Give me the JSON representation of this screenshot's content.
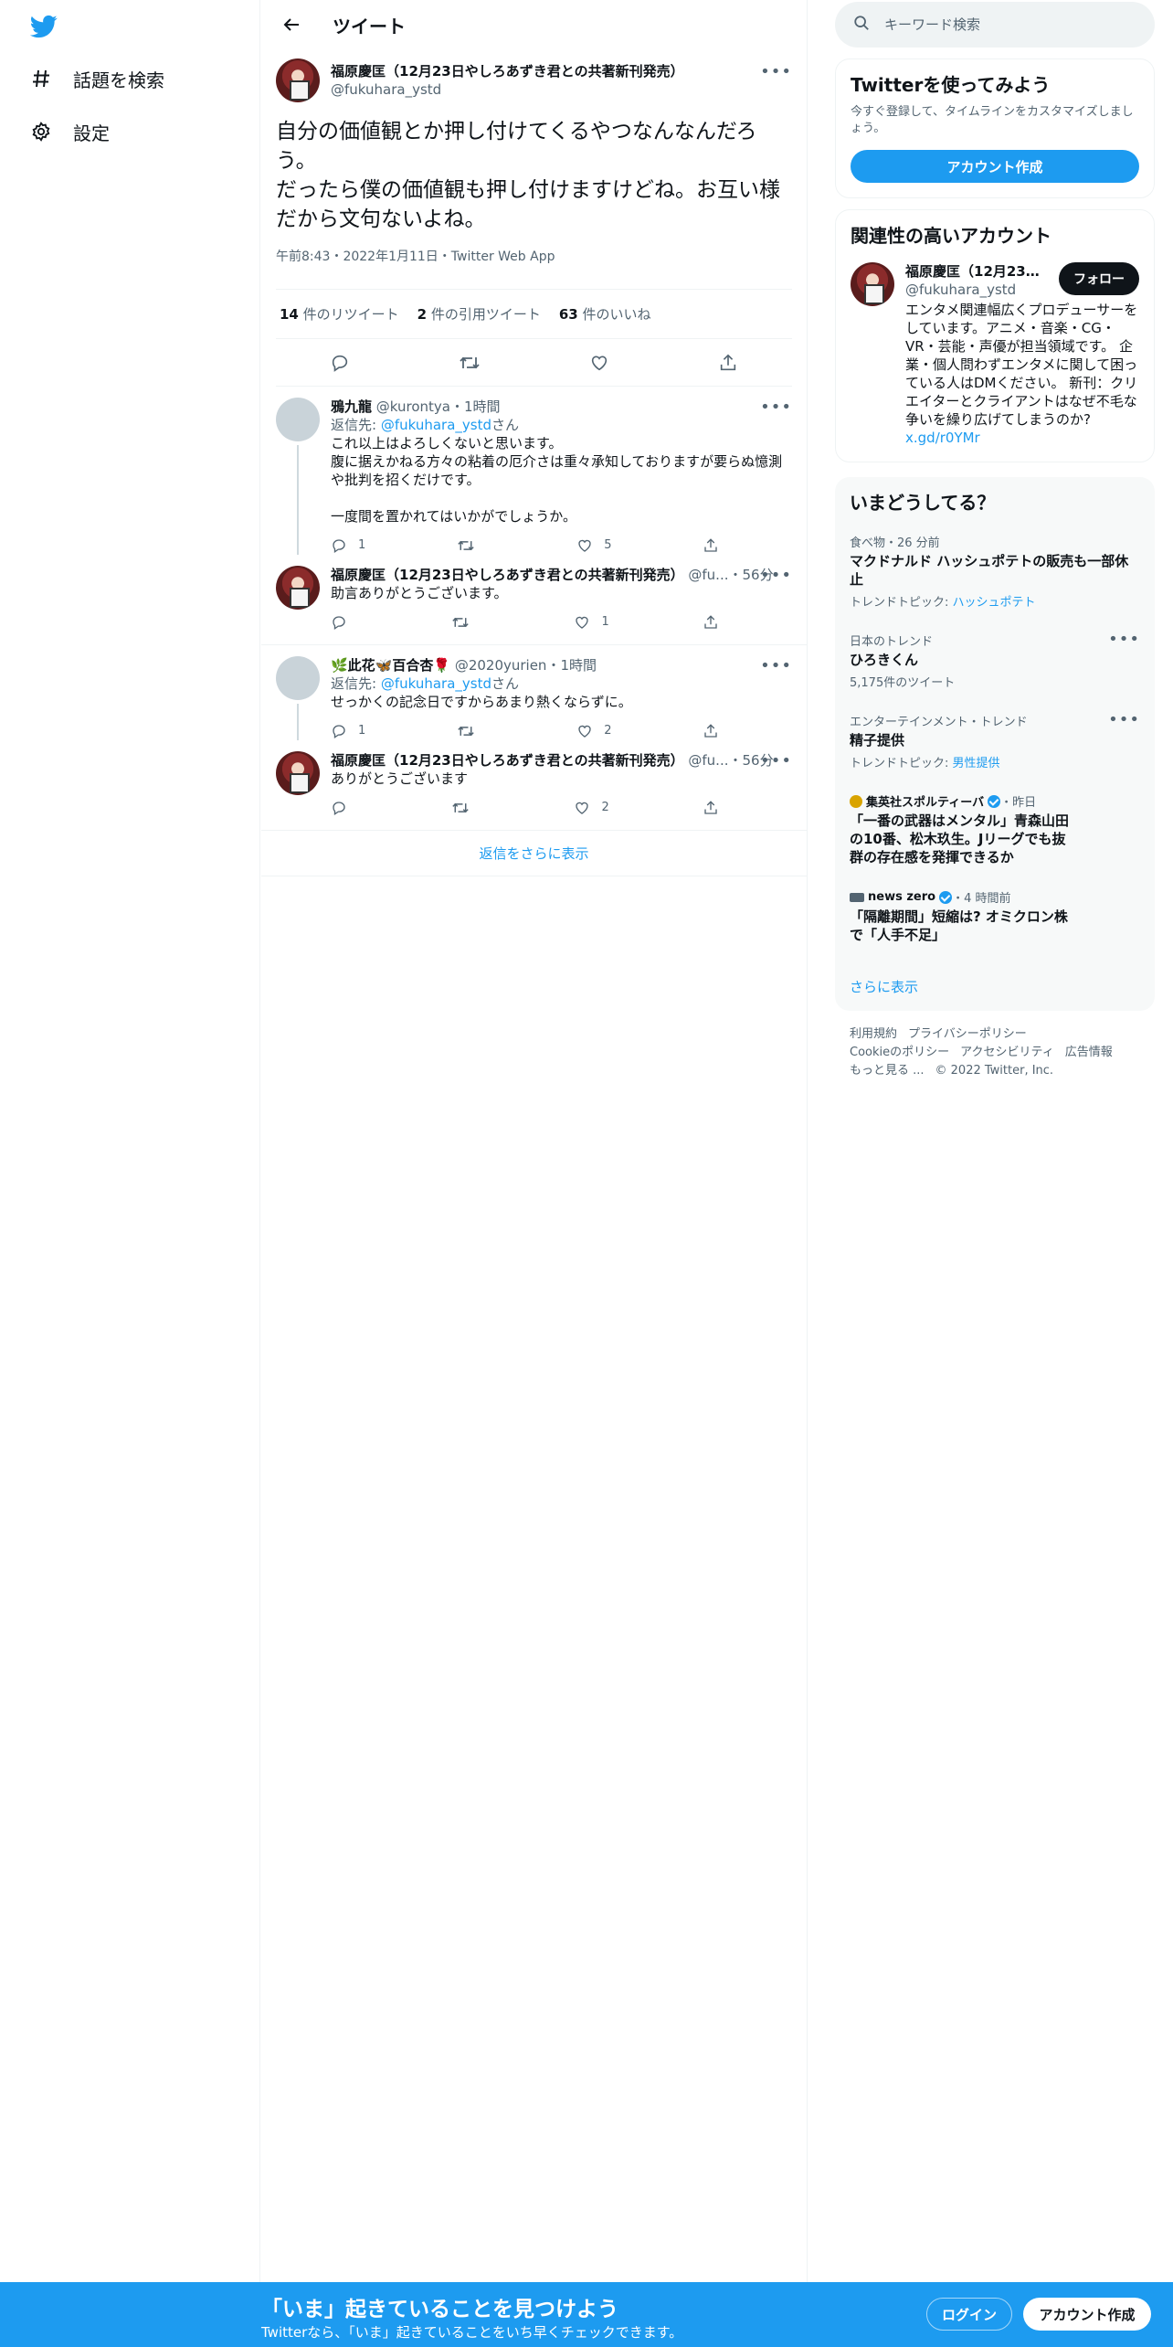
{
  "sidebar": {
    "items": [
      {
        "label": "話題を検索",
        "icon": "hashtag-icon"
      },
      {
        "label": "設定",
        "icon": "gear-icon"
      }
    ]
  },
  "header": {
    "title": "ツイート"
  },
  "tweet": {
    "name": "福原慶匡（12月23日やしろあずき君との共著新刊発売）",
    "handle": "@fukuhara_ystd",
    "text": "自分の価値観とか押し付けてくるやつなんなんだろう。\nだったら僕の価値観も押し付けますけどね。お互い様だから文句ないよね。",
    "meta": "午前8:43・2022年1月11日・Twitter Web App",
    "retweets_count": "14",
    "retweets_label": " 件のリツイート",
    "quotes_count": "2",
    "quotes_label": " 件の引用ツイート",
    "likes_count": "63",
    "likes_label": " 件のいいね"
  },
  "replies": [
    {
      "name": "鴉九龍",
      "handle": "@kurontya・1時間",
      "reply_prefix": "返信先: ",
      "reply_to": "@fukuhara_ystd",
      "reply_suffix": "さん",
      "text": "これ以上はよろしくないと思います。\n腹に据えかねる方々の粘着の厄介さは重々承知しておりますが要らぬ憶測や批判を招くだけです。\n\n一度間を置かれてはいかがでしょうか。",
      "replies": "1",
      "retweets": "",
      "likes": "5"
    },
    {
      "name": "福原慶匡（12月23日やしろあずき君との共著新刊発売）",
      "handle": "@fu...・56分",
      "text": "助言ありがとうございます。",
      "replies": "",
      "retweets": "",
      "likes": "1"
    },
    {
      "name": "🌿此花🦋百合杏🌹",
      "handle": "@2020yurien・1時間",
      "reply_prefix": "返信先: ",
      "reply_to": "@fukuhara_ystd",
      "reply_suffix": "さん",
      "text": "せっかくの記念日ですからあまり熱くならずに。",
      "replies": "1",
      "retweets": "",
      "likes": "2"
    },
    {
      "name": "福原慶匡（12月23日やしろあずき君との共著新刊発売）",
      "handle": "@fu...・56分",
      "text": "ありがとうございます",
      "replies": "",
      "retweets": "",
      "likes": "2"
    }
  ],
  "show_more_replies": "返信をさらに表示",
  "search": {
    "placeholder": "キーワード検索"
  },
  "signup_card": {
    "title": "Twitterを使ってみよう",
    "subtitle": "今すぐ登録して、タイムラインをカスタマイズしましょう。",
    "button": "アカウント作成"
  },
  "related": {
    "title": "関連性の高いアカウント",
    "name": "福原慶匡（12月23日...",
    "handle": "@fukuhara_ystd",
    "follow": "フォロー",
    "bio": "エンタメ関連幅広くプロデューサーをしています。アニメ・音楽・CG・VR・芸能・声優が担当領域です。 企業・個人問わずエンタメに関して困っている人はDMください。 新刊：クリエイターとクライアントはなぜ不毛な争いを繰り広げてしまうのか?",
    "link": "x.gd/r0YMr"
  },
  "trends": {
    "title": "いまどうしてる？",
    "items": [
      {
        "category": "食べ物・26 分前",
        "title": "マクドナルド ハッシュポテトの販売も一部休止",
        "sub_prefix": "トレンドトピック: ",
        "sub_link": "ハッシュポテト"
      },
      {
        "category": "日本のトレンド",
        "title": "ひろきくん",
        "sub": "5,175件のツイート"
      },
      {
        "category": "エンターテインメント・トレンド",
        "title": "精子提供",
        "sub_prefix": "トレンドトピック: ",
        "sub_link": "男性提供"
      },
      {
        "source": "集英社スポルティーバ",
        "time": "・昨日",
        "title": "「一番の武器はメンタル」青森山田の10番、松木玖生。Jリーグでも抜群の存在感を発揮できるか"
      },
      {
        "source": "news zero",
        "time": "・4 時間前",
        "title": "「隔離期間」短縮は? オミクロン株で「人手不足」"
      }
    ],
    "show_more": "さらに表示"
  },
  "footer": {
    "links": [
      "利用規約",
      "プライバシーポリシー",
      "Cookieのポリシー",
      "アクセシビリティ",
      "広告情報",
      "もっと見る ..."
    ],
    "copyright": "© 2022 Twitter, Inc."
  },
  "banner": {
    "title": "「いま」起きていることを見つけよう",
    "subtitle": "Twitterなら、「いま」起きていることをいち早くチェックできます。",
    "login": "ログイン",
    "signup": "アカウント作成"
  },
  "colors": {
    "accent": "#1d9bf0",
    "text": "#0f1419",
    "muted": "#536471"
  }
}
